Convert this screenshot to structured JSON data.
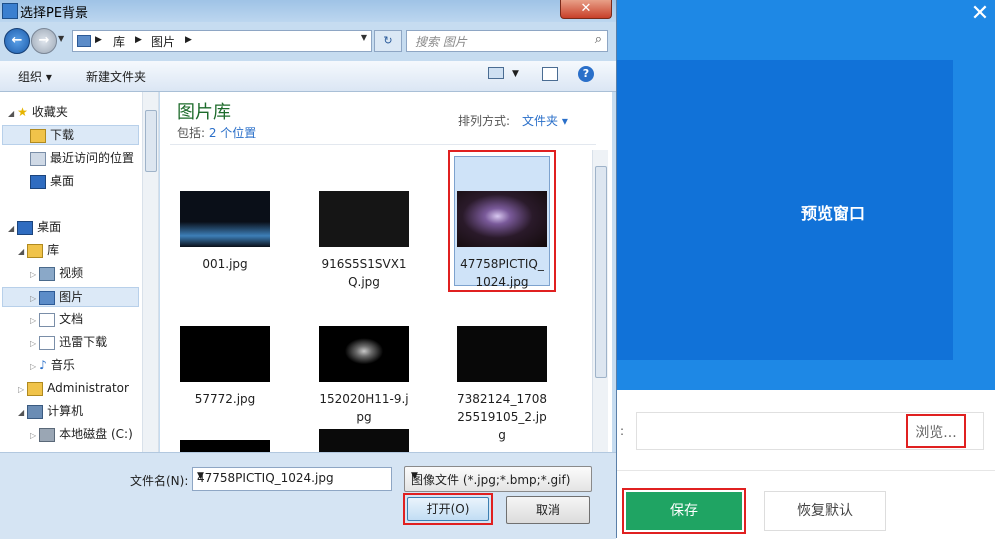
{
  "app": {
    "close_glyph": "✕",
    "preview_label": "预览窗口",
    "path_colon": ":",
    "browse_label": "浏览...",
    "save_label": "保存",
    "reset_label": "恢复默认"
  },
  "dialog": {
    "title": "选择PE背景",
    "close_glyph": "✕",
    "breadcrumb": [
      "库",
      "图片"
    ],
    "search_placeholder": "搜索 图片",
    "toolbar": {
      "organize": "组织 ▾",
      "new_folder": "新建文件夹"
    },
    "nav": [
      {
        "label": "收藏夹",
        "icon": "star-icon"
      },
      {
        "label": "下载",
        "icon": "download-folder-icon",
        "selected": true
      },
      {
        "label": "最近访问的位置",
        "icon": "recent-places-icon"
      },
      {
        "label": "桌面",
        "icon": "desktop-icon"
      },
      {
        "label": "桌面",
        "icon": "desktop-icon"
      },
      {
        "label": "库",
        "icon": "library-icon"
      },
      {
        "label": "视频",
        "icon": "video-icon"
      },
      {
        "label": "图片",
        "icon": "pictures-icon",
        "selected": true
      },
      {
        "label": "文档",
        "icon": "documents-icon"
      },
      {
        "label": "迅雷下载",
        "icon": "thunder-download-icon"
      },
      {
        "label": "音乐",
        "icon": "music-icon"
      },
      {
        "label": "Administrator",
        "icon": "user-folder-icon"
      },
      {
        "label": "计算机",
        "icon": "computer-icon"
      },
      {
        "label": "本地磁盘 (C:)",
        "icon": "disk-icon"
      }
    ],
    "library": {
      "title": "图片库",
      "includes_prefix": "包括: ",
      "includes_link": "2 个位置",
      "sort_label": "排列方式:",
      "sort_value": "文件夹 ▾"
    },
    "files": [
      {
        "name": "001.jpg"
      },
      {
        "name": "916S5S1SVX1Q.jpg"
      },
      {
        "name": "47758PICTIQ_1024.jpg",
        "selected": true
      },
      {
        "name": "57772.jpg"
      },
      {
        "name": "152020H11-9.jpg"
      },
      {
        "name": "7382124_170825519105_2.jpg"
      }
    ],
    "filename_label": "文件名(N):",
    "filename_value": "47758PICTIQ_1024.jpg",
    "filetype_value": "图像文件 (*.jpg;*.bmp;*.gif)",
    "open_label": "打开(O)",
    "cancel_label": "取消"
  }
}
